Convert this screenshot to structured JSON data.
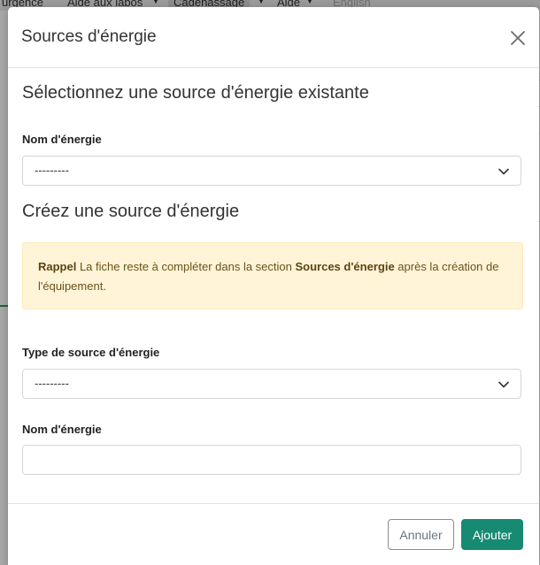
{
  "background": {
    "nav_items": [
      "urgence",
      "Aide aux labos",
      "Cadenassage",
      "Aide",
      "English"
    ]
  },
  "modal": {
    "title": "Sources d'énergie",
    "close_icon": "close-icon",
    "existing_section": {
      "heading": "Sélectionnez une source d'énergie existante",
      "energy_name_label": "Nom d'énergie",
      "energy_name_selected": "---------"
    },
    "create_section": {
      "heading": "Créez une source d'énergie",
      "alert": {
        "strong_prefix": "Rappel",
        "text_before": " La fiche reste à compléter dans la section ",
        "strong_section": "Sources d'énergie",
        "text_after": " après la création de l'équipement."
      },
      "source_type_label": "Type de source d'énergie",
      "source_type_selected": "---------",
      "energy_name_label": "Nom d'énergie",
      "energy_name_value": ""
    },
    "footer": {
      "cancel_label": "Annuler",
      "add_label": "Ajouter"
    }
  },
  "colors": {
    "primary_button": "#178a72",
    "alert_background": "#fff4d8",
    "alert_text": "#6b5218"
  }
}
